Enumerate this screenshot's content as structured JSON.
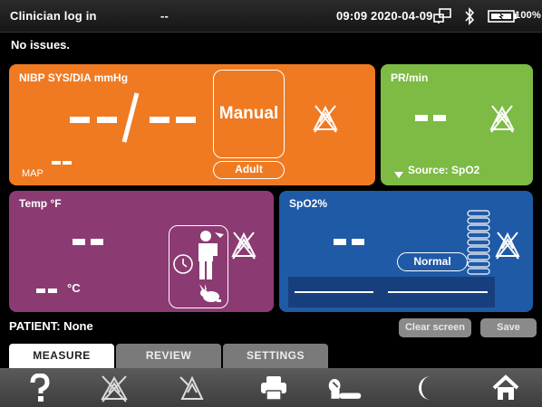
{
  "status": {
    "role": "Clinician log in",
    "placeholder": "--",
    "datetime": "09:09 2020-04-09",
    "battery": "100%"
  },
  "message": "No issues.",
  "nibp": {
    "label": "NIBP SYS/DIA mmHg",
    "value": "--/--",
    "mode": "Manual",
    "patient_type": "Adult",
    "map_label": "MAP"
  },
  "pr": {
    "label": "PR/min",
    "source": "Source: SpO2"
  },
  "temp": {
    "label": "Temp °F",
    "celsius_unit": "°C"
  },
  "spo2": {
    "label": "SpO2%",
    "response": "Normal"
  },
  "patient": "PATIENT: None",
  "buttons": {
    "clear": "Clear screen",
    "save": "Save"
  },
  "tabs": [
    "MEASURE",
    "REVIEW",
    "SETTINGS"
  ],
  "colors": {
    "nibp": "#f07a22",
    "pr": "#7dbb45",
    "temp": "#8b3b72",
    "spo2": "#1f5aa6"
  },
  "nav_icons": [
    "help-icon",
    "alarms-off-icon",
    "alarm-audio-pause-icon",
    "print-icon",
    "patient-sleep-icon",
    "night-mode-icon",
    "home-icon"
  ]
}
